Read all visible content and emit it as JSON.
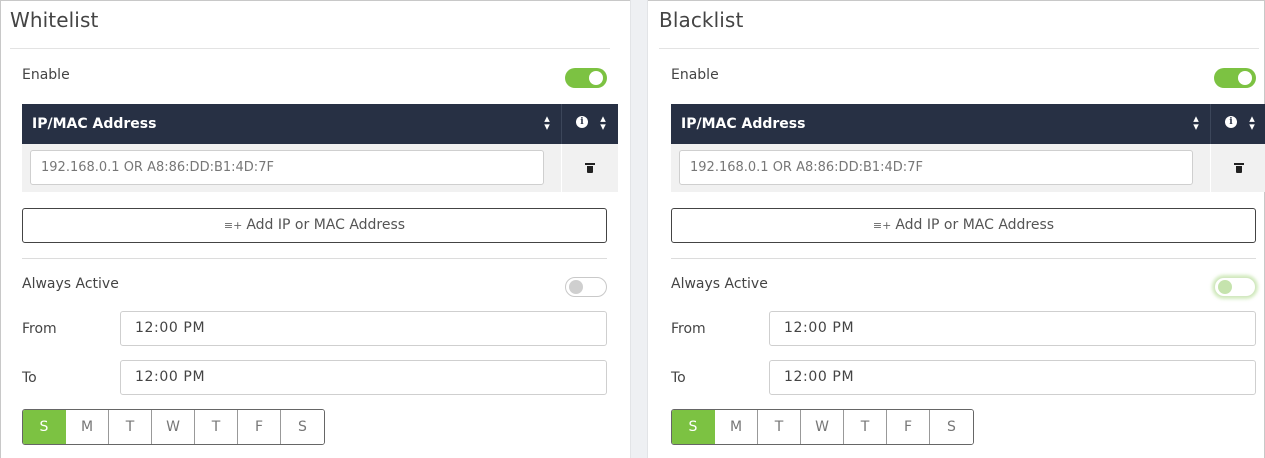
{
  "colors": {
    "accent": "#7cc242",
    "header_bg": "#273044"
  },
  "panels": [
    {
      "title": "Whitelist",
      "enable_label": "Enable",
      "enable_state": "on",
      "table_header": "IP/MAC Address",
      "address_placeholder": "192.168.0.1 OR A8:86:DD:B1:4D:7F",
      "add_button_label": "Add IP or MAC Address",
      "always_active_label": "Always Active",
      "always_active_state": "off",
      "from_label": "From",
      "from_value": "12:00 PM",
      "to_label": "To",
      "to_value": "12:00 PM",
      "days": [
        "S",
        "M",
        "T",
        "W",
        "T",
        "F",
        "S"
      ],
      "selected_day_index": 0
    },
    {
      "title": "Blacklist",
      "enable_label": "Enable",
      "enable_state": "on",
      "table_header": "IP/MAC Address",
      "address_placeholder": "192.168.0.1 OR A8:86:DD:B1:4D:7F",
      "add_button_label": "Add IP or MAC Address",
      "always_active_label": "Always Active",
      "always_active_state": "off-focused",
      "from_label": "From",
      "from_value": "12:00 PM",
      "to_label": "To",
      "to_value": "12:00 PM",
      "days": [
        "S",
        "M",
        "T",
        "W",
        "T",
        "F",
        "S"
      ],
      "selected_day_index": 0
    }
  ],
  "icons": {
    "sort": "sort-icon",
    "info": "info-icon",
    "trash": "trash-icon",
    "add_list": "add-list-icon"
  }
}
